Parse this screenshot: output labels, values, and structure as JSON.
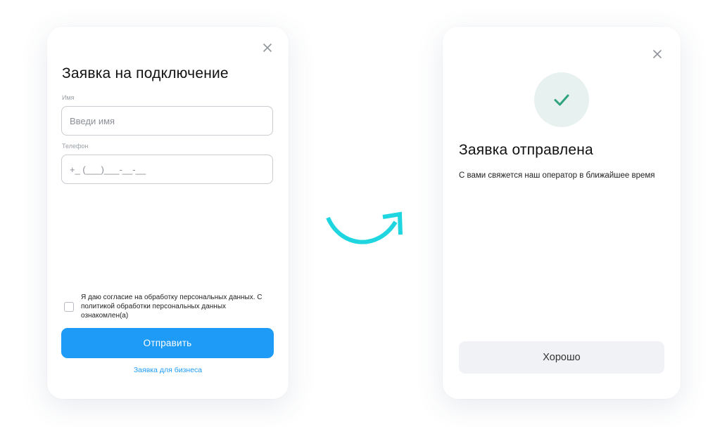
{
  "form_modal": {
    "title": "Заявка на подключение",
    "name_field": {
      "label": "Имя",
      "placeholder": "Введи имя",
      "value": ""
    },
    "phone_field": {
      "label": "Телефон",
      "placeholder": "+_ (___)___-__-__",
      "value": ""
    },
    "consent": {
      "checked": false,
      "text": "Я даю согласие на обработку персональных данных. С политикой обработки персональных данных ознакомлен(а)"
    },
    "submit_label": "Отправить",
    "business_link": "Заявка для бизнеса",
    "close_icon": "close-icon"
  },
  "flow_arrow": {
    "icon": "curved-arrow-icon",
    "color": "#1fd6e0"
  },
  "success_modal": {
    "title": "Заявка отправлена",
    "description": "С вами свяжется наш оператор в ближайшее время",
    "ok_label": "Хорошо",
    "check_icon": "checkmark-icon",
    "close_icon": "close-icon"
  },
  "colors": {
    "primary": "#1e9bf7",
    "success": "#2fa37c",
    "success_bg": "#e7f1ef",
    "secondary_button": "#f1f2f5"
  }
}
